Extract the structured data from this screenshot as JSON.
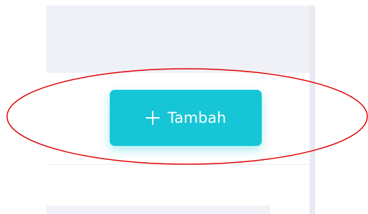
{
  "toolbar": {
    "add_button": {
      "label": "Tambah",
      "icon": "plus-icon",
      "color": "#17c6d6"
    }
  },
  "annotation": {
    "shape": "ellipse",
    "color": "#e00000"
  }
}
